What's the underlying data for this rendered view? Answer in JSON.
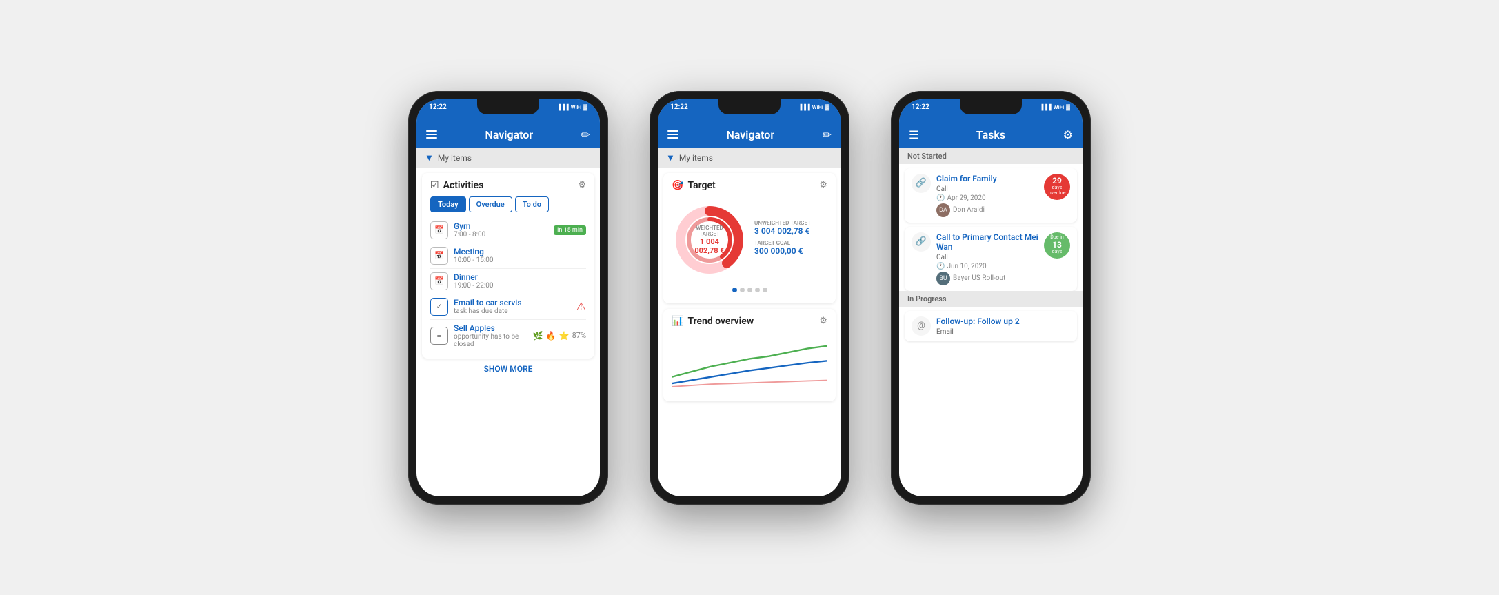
{
  "phone1": {
    "status_time": "12:22",
    "header_title": "Navigator",
    "filter_label": "My items",
    "widget_title": "Activities",
    "tabs": [
      "Today",
      "Overdue",
      "To do"
    ],
    "active_tab": 0,
    "activities": [
      {
        "name": "Gym",
        "time": "7:00 - 8:00",
        "icon": "📅",
        "badge": "In 15 min",
        "badge_type": "green"
      },
      {
        "name": "Meeting",
        "time": "10:00 - 15:00",
        "icon": "📅",
        "badge": "",
        "badge_type": ""
      },
      {
        "name": "Dinner",
        "time": "19:00 - 22:00",
        "icon": "📅",
        "badge": "",
        "badge_type": ""
      },
      {
        "name": "Email to car servis",
        "time": "task has due date",
        "icon": "✓",
        "badge": "!",
        "badge_type": "red_dot"
      },
      {
        "name": "Sell Apples",
        "time": "opportunity has to be closed",
        "icon": "≡",
        "badge": "87%",
        "badge_type": "icons"
      }
    ],
    "show_more": "SHOW MORE"
  },
  "phone2": {
    "status_time": "12:22",
    "header_title": "Navigator",
    "filter_label": "My items",
    "target_title": "Target",
    "donut_label": "WEIGHTED TARGET",
    "donut_value": "1 004 002,78 €",
    "unweighted_label": "UNWEIGHTED TARGET",
    "unweighted_value": "3 004 002,78 €",
    "goal_label": "TARGET GOAL",
    "goal_value": "300 000,00 €",
    "trend_title": "Trend overview",
    "dots": [
      true,
      false,
      false,
      false,
      false
    ]
  },
  "phone3": {
    "status_time": "12:22",
    "header_title": "Tasks",
    "section1": "Not Started",
    "section2": "In Progress",
    "tasks": [
      {
        "title": "Claim for Family",
        "icon": "🔗",
        "type": "Call",
        "date": "Apr 29, 2020",
        "person": "Don Araldi",
        "badge_num": "29",
        "badge_text": "days overdue",
        "badge_type": "overdue"
      },
      {
        "title": "Call to Primary Contact Mei Wan",
        "icon": "🔗",
        "type": "Call",
        "date": "Jun 10, 2020",
        "person": "Bayer US Roll-out",
        "badge_num": "13",
        "badge_text": "Due in days",
        "badge_type": "due"
      },
      {
        "title": "Follow-up: Follow up 2",
        "icon": "@",
        "type": "Email",
        "date": "",
        "person": "",
        "badge_num": "",
        "badge_text": "",
        "badge_type": "none"
      }
    ]
  }
}
